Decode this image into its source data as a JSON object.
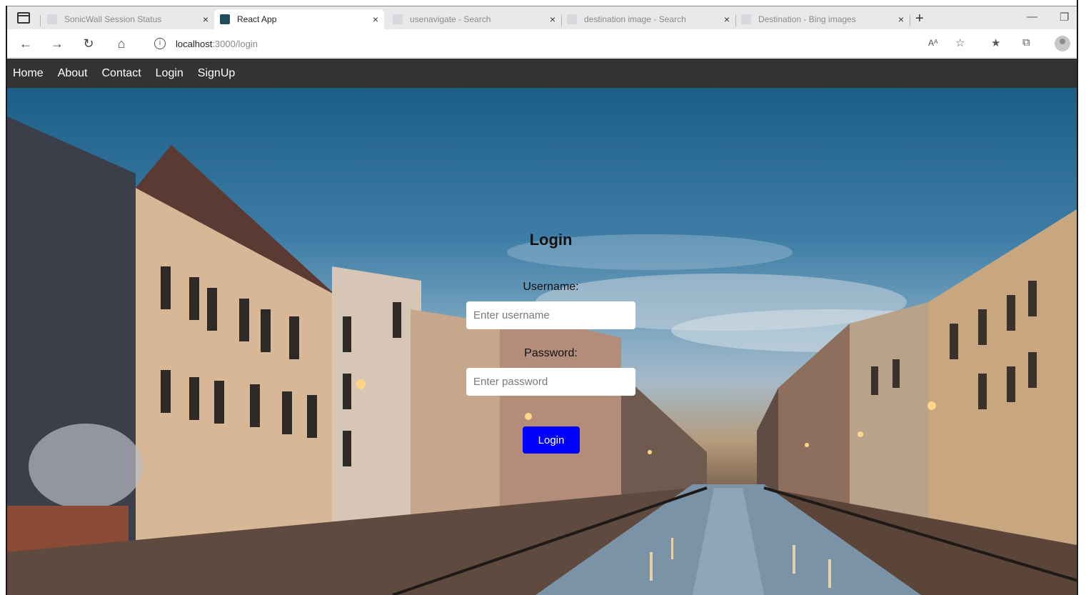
{
  "browser": {
    "tabs": [
      {
        "label": "SonicWall Session Status",
        "active": false
      },
      {
        "label": "React App",
        "active": true
      },
      {
        "label": "usenavigate - Search",
        "active": false
      },
      {
        "label": "destination image - Search",
        "active": false
      },
      {
        "label": "Destination - Bing images",
        "active": false
      }
    ],
    "close_glyph": "×",
    "new_tab_glyph": "+",
    "url_host": "localhost",
    "url_path": ":3000/login",
    "read_aloud_glyph": "Aᴬ"
  },
  "nav": {
    "items": [
      "Home",
      "About",
      "Contact",
      "Login",
      "SignUp"
    ]
  },
  "login": {
    "title": "Login",
    "username_label": "Username:",
    "username_placeholder": "Enter username",
    "password_label": "Password:",
    "password_placeholder": "Enter password",
    "submit_label": "Login"
  },
  "colors": {
    "nav_bg": "#333333",
    "button_bg": "#0000ff",
    "button_text": "#ffffff"
  }
}
